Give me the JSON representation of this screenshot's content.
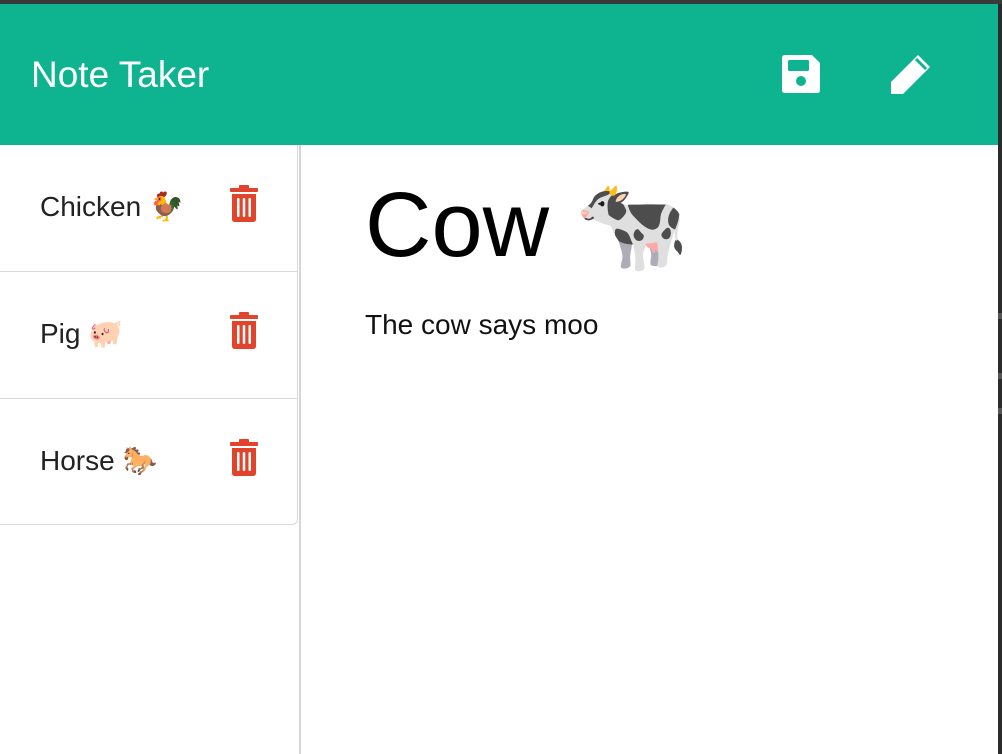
{
  "app": {
    "title": "Note Taker"
  },
  "toolbar": {
    "save_icon": "floppy-disk-icon",
    "edit_icon": "pencil-icon"
  },
  "notes": [
    {
      "title": "Chicken 🐓",
      "delete_icon": "trash-icon"
    },
    {
      "title": "Pig 🐖",
      "delete_icon": "trash-icon"
    },
    {
      "title": "Horse 🐎",
      "delete_icon": "trash-icon"
    }
  ],
  "active_note": {
    "title": "Cow 🐄",
    "text": "The cow says moo"
  },
  "colors": {
    "navbar": "#0eb38f",
    "delete": "#e2432b",
    "icon": "#ffffff"
  }
}
